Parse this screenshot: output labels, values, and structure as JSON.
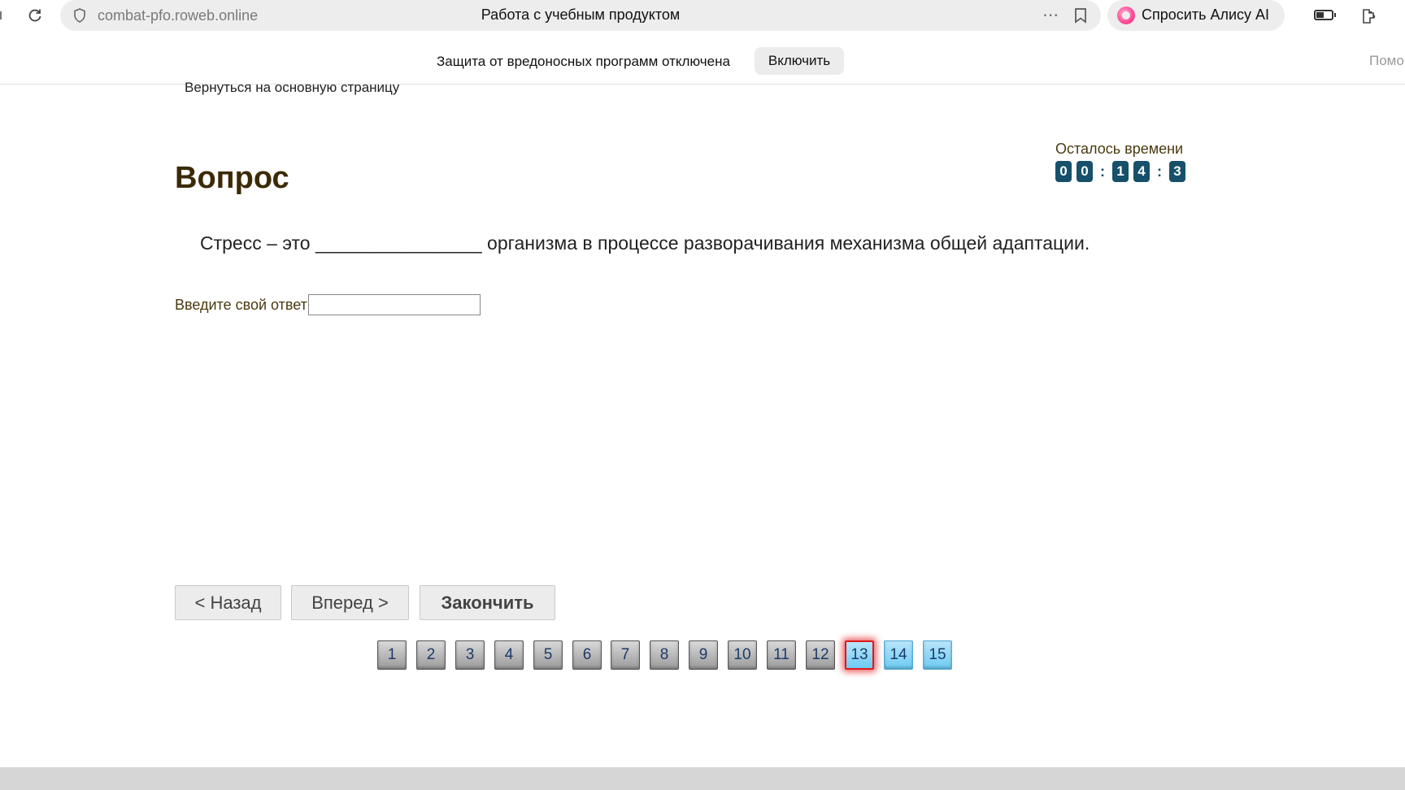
{
  "browser": {
    "url": "combat-pfo.roweb.online",
    "page_title": "Работа с учебным продуктом",
    "more_icon": "⋯",
    "alice_label": "Спросить Алису AI"
  },
  "notification": {
    "text": "Защита от вредоносных программ отключена",
    "enable_label": "Включить",
    "help_label": "Помощь"
  },
  "page": {
    "back_link": "Вернуться на основную страницу",
    "timer_label": "Осталось времени",
    "timer_digits": [
      "0",
      "0",
      "1",
      "4",
      "3"
    ],
    "heading": "Вопрос",
    "question": "Стресс – это ________________ организма в процессе разворачивания механизма общей адаптации.",
    "answer_label": "Введите свой ответ",
    "answer_value": ""
  },
  "navigation": {
    "back_label": "< Назад",
    "next_label": "Вперед >",
    "finish_label": "Закончить"
  },
  "pagination": {
    "pages": [
      "1",
      "2",
      "3",
      "4",
      "5",
      "6",
      "7",
      "8",
      "9",
      "10",
      "11",
      "12",
      "13",
      "14",
      "15"
    ],
    "current": "13",
    "unvisited": [
      "14",
      "15"
    ]
  },
  "colors": {
    "timer_digit_bg": "#16506b",
    "heading": "#3b2a05",
    "current_page_border": "#e01818",
    "unvisited_page": "#6ccbf2"
  }
}
